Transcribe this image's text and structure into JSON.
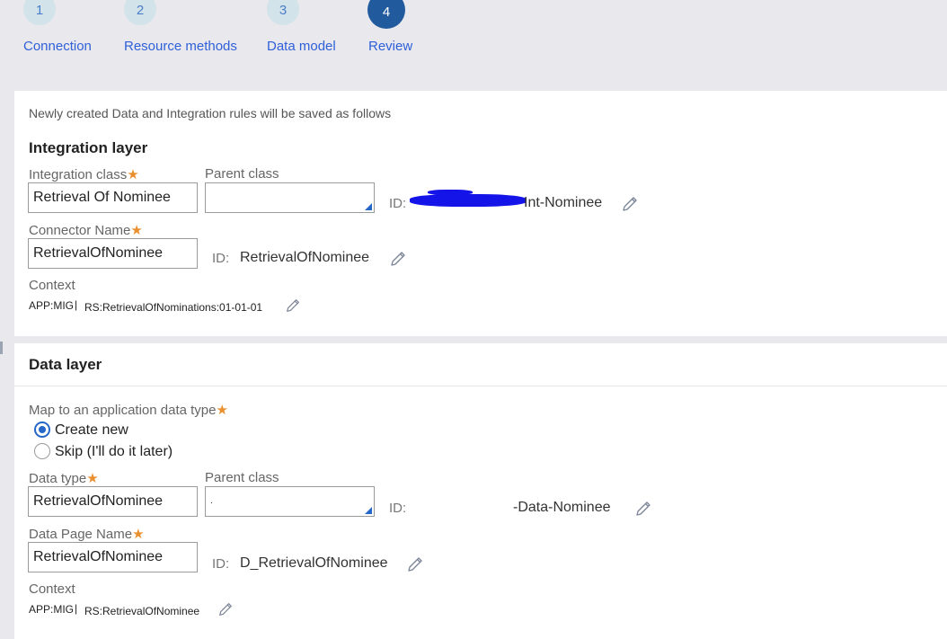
{
  "wizard": {
    "steps": [
      {
        "number": "1",
        "label": "Connection"
      },
      {
        "number": "2",
        "label": "Resource methods"
      },
      {
        "number": "3",
        "label": "Data model"
      },
      {
        "number": "4",
        "label": "Review",
        "active": true
      }
    ]
  },
  "integration": {
    "intro": "Newly created Data and Integration rules will be saved as follows",
    "title": "Integration layer",
    "integration_class": {
      "label": "Integration class",
      "required": "★",
      "value": "Retrieval Of Nominee"
    },
    "parent_class": {
      "label": "Parent class",
      "value": ""
    },
    "class_id": {
      "label": "ID:",
      "value": "Int-Nominee"
    },
    "connector_name": {
      "label": "Connector Name",
      "required": "★",
      "value": "RetrievalOfNominee"
    },
    "connector_id": {
      "label": "ID:",
      "value": "RetrievalOfNominee"
    },
    "context": {
      "label": "Context",
      "app": "APP:MIG",
      "separator": "|",
      "ruleset": "RS:RetrievalOfNominations:01-01-01"
    }
  },
  "data_layer": {
    "title": "Data layer",
    "map_label": "Map to an application data type",
    "required": "★",
    "options": [
      {
        "label": "Create new",
        "checked": true
      },
      {
        "label": "Skip (I'll do it later)",
        "checked": false
      }
    ],
    "data_type": {
      "label": "Data type",
      "required": "★",
      "value": "RetrievalOfNominee"
    },
    "parent_class": {
      "label": "Parent class",
      "value": "."
    },
    "class_id": {
      "label": "ID:",
      "value": "-Data-Nominee"
    },
    "data_page_name": {
      "label": "Data Page Name",
      "required": "★",
      "value": "RetrievalOfNominee"
    },
    "page_id": {
      "label": "ID:",
      "value": "D_RetrievalOfNominee"
    },
    "context": {
      "label": "Context",
      "app": "APP:MIG",
      "separator": "|",
      "ruleset": "RS:RetrievalOfNominee"
    }
  },
  "colors": {
    "accent": "#2567c9",
    "step_active": "#225a9e",
    "step_inactive": "#d3e3ea",
    "link": "#2f60d8",
    "required": "#e98f2d",
    "redaction": "#1414e8"
  },
  "icons": {
    "edit": "pencil-icon",
    "picker": "dropdown-corner-icon"
  }
}
